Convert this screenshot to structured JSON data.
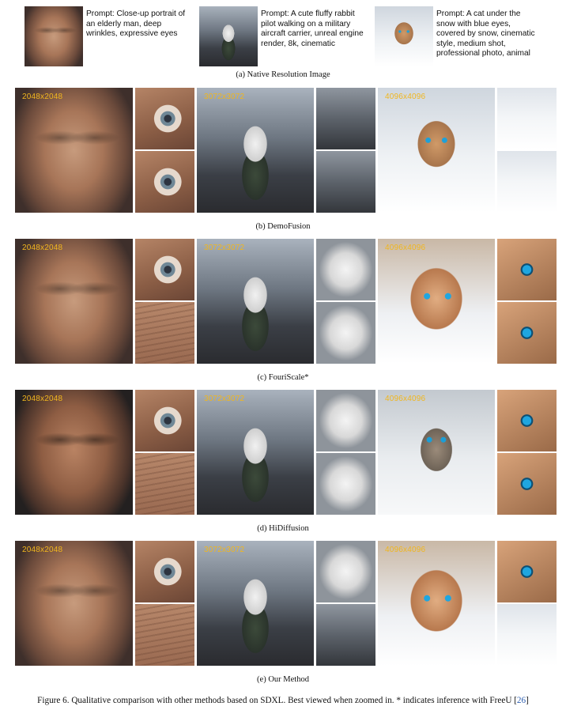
{
  "native": {
    "prompts": [
      "Prompt: Close-up portrait of\nan elderly man, deep\nwrinkles, expressive eyes",
      "Prompt: A cute fluffy rabbit\npilot walking on a military\naircraft carrier, unreal engine\nrender, 8k, cinematic",
      "Prompt: A cat under the\nsnow with blue eyes,\ncovered by snow, cinematic\nstyle, medium shot,\nprofessional photo, animal"
    ],
    "caption": "(a) Native Resolution Image"
  },
  "rows": [
    {
      "caption": "(b) DemoFusion",
      "labels": [
        "2048x2048",
        "3072x3072",
        "4096x4096"
      ]
    },
    {
      "caption": "(c) FouriScale*",
      "labels": [
        "2048x2048",
        "3072x3072",
        "4096x4096"
      ]
    },
    {
      "caption": "(d) HiDiffusion",
      "labels": [
        "2048x2048",
        "3072x3072",
        "4096x4096"
      ]
    },
    {
      "caption": "(e) Our Method",
      "labels": [
        "2048x2048",
        "3072x3072",
        "4096x4096"
      ]
    }
  ],
  "figure_caption": {
    "text": "Figure 6. Qualitative comparison with other methods based on SDXL. Best viewed when zoomed in. * indicates inference with FreeU [",
    "ref": "26",
    "close": "]"
  },
  "colors": {
    "resolution_label": "#f0b61e",
    "reference_link": "#2f5fb0"
  }
}
